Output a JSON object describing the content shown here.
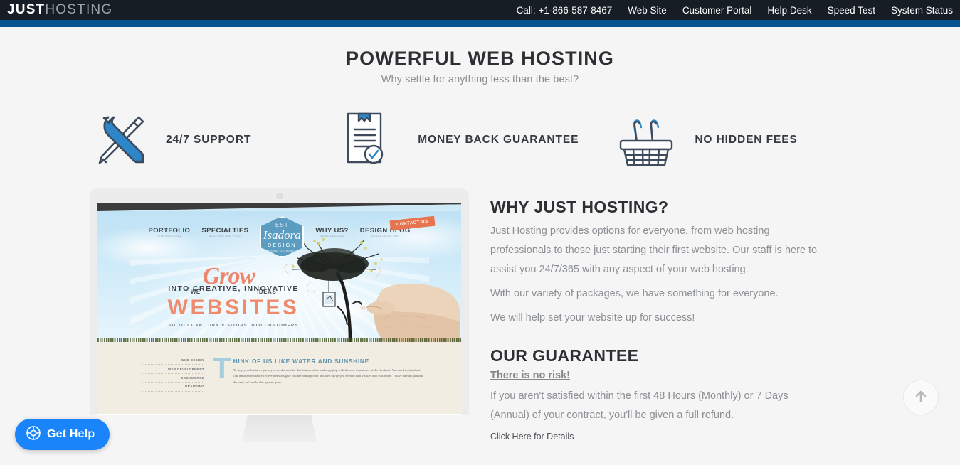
{
  "header": {
    "logo_just": "JUST",
    "logo_hosting": "HOSTING",
    "nav": [
      {
        "label": "Call: +1-866-587-8467",
        "name": "nav-item-call"
      },
      {
        "label": "Web Site",
        "name": "nav-item-web-site"
      },
      {
        "label": "Customer Portal",
        "name": "nav-item-customer-portal"
      },
      {
        "label": "Help Desk",
        "name": "nav-item-help-desk"
      },
      {
        "label": "Speed Test",
        "name": "nav-item-speed-test"
      },
      {
        "label": "System Status",
        "name": "nav-item-system-status"
      }
    ],
    "bar_color": "#161d24",
    "stripe_color": "#075490"
  },
  "hero": {
    "title": "POWERFUL WEB HOSTING",
    "subtitle": "Why settle for anything less than the best?"
  },
  "features": [
    {
      "label": "24/7 SUPPORT",
      "icon": "wrench-screwdriver-icon"
    },
    {
      "label": "MONEY BACK GUARANTEE",
      "icon": "clipboard-check-icon"
    },
    {
      "label": "NO HIDDEN FEES",
      "icon": "shopping-basket-icon"
    }
  ],
  "why": {
    "title": "WHY JUST HOSTING?",
    "paragraph1": "Just Hosting provides options for everyone, from web hosting professionals to those just starting their first website. Our staff is here to assist you 24/7/365 with any aspect of your web hosting.",
    "paragraph2": "With our variety of packages, we have something for everyone.",
    "paragraph3": "We will help set your website up for success!"
  },
  "guarantee": {
    "title": "OUR GUARANTEE",
    "risk_link": "There is no risk!",
    "body": "If you aren't satisfied within the first 48 Hours (Monthly) or 7 Days (Annual) of your contract, you'll be given a full refund.",
    "details_link": "Click Here for Details"
  },
  "get_help": {
    "label": "Get Help",
    "icon": "lifering-icon",
    "color": "#1a85fb"
  },
  "scroll_top": {
    "icon": "arrow-up-icon"
  },
  "monitor_mockup": {
    "nav": [
      {
        "title": "PORTFOLIO",
        "sub": "FEATURED WORK"
      },
      {
        "title": "SPECIALTIES",
        "sub": "WHAT WE LOVE TO DO"
      },
      {
        "title": "WHY US?",
        "sub": "WE'RE AWESOME"
      },
      {
        "title": "DESIGN BLOG",
        "sub": "WORDS WE'VE SAID"
      }
    ],
    "badge": {
      "top": "EST",
      "name": "Isadora",
      "sub": "DESIGN",
      "tagline": "HANDCRAFTED WEBSITES"
    },
    "contact_tag": "CONTACT US",
    "headline": {
      "we": "WE",
      "grow": "Grow",
      "ideas": "IDEAS",
      "line2": "INTO    CREATIVE, INNOVATIVE",
      "line3": "WEBSITES",
      "line4": "SO YOU CAN TURN VISITORS INTO CUSTOMERS"
    },
    "services": [
      "WEB DESIGN",
      "WEB DEVELOPMENT",
      "ECOMMERCE",
      "BRANDING"
    ],
    "lower": {
      "dropcap": "T",
      "heading": "HINK OF US LIKE WATER AND SUNSHINE",
      "paragraph": "To help your business grow, you need a website that is innovative and engaging with the user experience at the forefront. You need to stand out. Our handcrafted and effective websites give you the brand power and web savvy you need to turn visitors into customers. You've already planted the seed, let's make this garden grow."
    }
  }
}
